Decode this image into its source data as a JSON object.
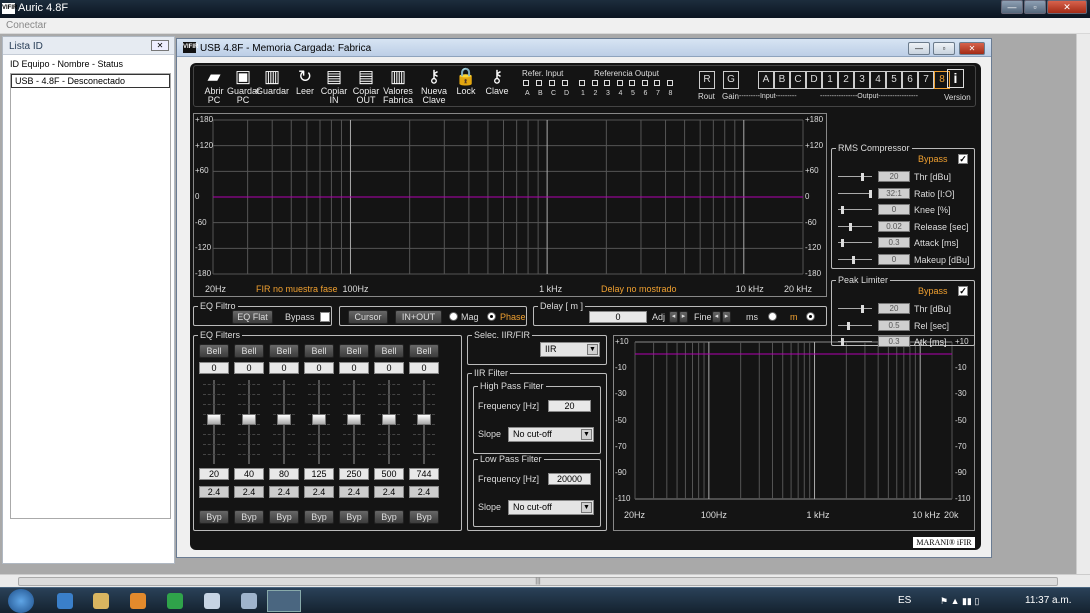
{
  "app": {
    "title": "Auric 4.8F",
    "logo": "VIFIR",
    "menu": "Conectar"
  },
  "list_window": {
    "title": "Lista ID",
    "column_header": "ID Equipo - Nombre - Status",
    "rows": [
      "USB - 4.8F - Desconectado"
    ]
  },
  "eq_window": {
    "title": "USB  4.8F  - Memoria Cargada: Fabrica"
  },
  "toolbar": [
    {
      "label1": "Abrir",
      "label2": "PC",
      "icon": "folder-icon"
    },
    {
      "label1": "Guardar",
      "label2": "PC",
      "icon": "save-icon"
    },
    {
      "label1": "Guardar",
      "label2": "",
      "icon": "chip-icon"
    },
    {
      "label1": "Leer",
      "label2": "",
      "icon": "refresh-icon"
    },
    {
      "label1": "Copiar",
      "label2": "IN",
      "icon": "copy-icon"
    },
    {
      "label1": "Copiar",
      "label2": "OUT",
      "icon": "copy-icon"
    },
    {
      "label1": "Valores",
      "label2": "Fabrica",
      "icon": "chip-icon"
    },
    {
      "label1": "Nueva",
      "label2": "Clave",
      "icon": "key-icon"
    },
    {
      "label1": "Lock",
      "label2": "",
      "icon": "lock-icon"
    },
    {
      "label1": "Clave",
      "label2": "",
      "icon": "key-icon"
    }
  ],
  "refer_input": {
    "title": "Refer. Input",
    "labels": [
      "A",
      "B",
      "C",
      "D"
    ]
  },
  "ref_output": {
    "title": "Referencia Output",
    "labels": [
      "1",
      "2",
      "3",
      "4",
      "5",
      "6",
      "7",
      "8"
    ]
  },
  "route_gain": [
    {
      "btn": "R",
      "label": "Rout"
    },
    {
      "btn": "G",
      "label": "Gain"
    }
  ],
  "input_channels": [
    "A",
    "B",
    "C",
    "D"
  ],
  "output_channels": [
    "1",
    "2",
    "3",
    "4",
    "5",
    "6",
    "7",
    "8"
  ],
  "selected_output": "8",
  "input_caption": "---------Input---------",
  "output_caption": "----------------Output-----------------",
  "version": {
    "label": "Version",
    "icon": "i"
  },
  "main_graph": {
    "y_ticks": [
      "+180",
      "+120",
      "+60",
      "0",
      "-60",
      "-120",
      "-180"
    ],
    "x_labels": [
      "20Hz",
      "100Hz",
      "1 kHz",
      "10 kHz",
      "20 kHz"
    ],
    "note_fir": "FIR no muestra fase",
    "note_delay": "Delay no mostrado",
    "trace_color": "#b000b0"
  },
  "eq_filtro": {
    "title": "EQ Filtro",
    "eq_flat": "EQ Flat",
    "bypass": "Bypass"
  },
  "display_opts": {
    "cursor": "Cursor",
    "in_out": "IN+OUT",
    "mag": "Mag",
    "phase": "Phase",
    "selected": "Phase"
  },
  "delay": {
    "title": "Delay [ m ]",
    "value": "0",
    "adj": "Adj",
    "fine": "Fine",
    "ms": "ms",
    "m": "m",
    "unit": "m"
  },
  "eq_filters": {
    "title": "EQ Filters",
    "bands": [
      {
        "type": "Bell",
        "gain": "0",
        "freq": "20",
        "q": "2.4",
        "byp": "Byp"
      },
      {
        "type": "Bell",
        "gain": "0",
        "freq": "40",
        "q": "2.4",
        "byp": "Byp"
      },
      {
        "type": "Bell",
        "gain": "0",
        "freq": "80",
        "q": "2.4",
        "byp": "Byp"
      },
      {
        "type": "Bell",
        "gain": "0",
        "freq": "125",
        "q": "2.4",
        "byp": "Byp"
      },
      {
        "type": "Bell",
        "gain": "0",
        "freq": "250",
        "q": "2.4",
        "byp": "Byp"
      },
      {
        "type": "Bell",
        "gain": "0",
        "freq": "500",
        "q": "2.4",
        "byp": "Byp"
      },
      {
        "type": "Bell",
        "gain": "0",
        "freq": "744",
        "q": "2.4",
        "byp": "Byp"
      }
    ]
  },
  "selec": {
    "title": "Selec. IIR/FIR",
    "value": "IIR"
  },
  "iir": {
    "title": "IIR Filter",
    "hp": {
      "title": "High Pass Filter",
      "freq_label": "Frequency [Hz]",
      "freq": "20",
      "slope_label": "Slope",
      "slope": "No cut-off"
    },
    "lp": {
      "title": "Low Pass Filter",
      "freq_label": "Frequency [Hz]",
      "freq": "20000",
      "slope_label": "Slope",
      "slope": "No cut-off"
    }
  },
  "small_graph": {
    "y_ticks": [
      "+10",
      "-10",
      "-30",
      "-50",
      "-70",
      "-90",
      "-110"
    ],
    "x_labels": [
      "20Hz",
      "100Hz",
      "1 kHz",
      "10 kHz",
      "20k"
    ]
  },
  "rms": {
    "title": "RMS Compressor",
    "bypass": "Bypass",
    "params": [
      {
        "value": "20",
        "label": "Thr [dBu]",
        "level": 0.75
      },
      {
        "value": "32:1",
        "label": "Ratio [I:O]",
        "level": 1.0
      },
      {
        "value": "0",
        "label": "Knee [%]",
        "level": 0.1
      },
      {
        "value": "0.02",
        "label": "Release [sec]",
        "level": 0.35
      },
      {
        "value": "0.3",
        "label": "Attack [ms]",
        "level": 0.1
      },
      {
        "value": "0",
        "label": "Makeup [dBu]",
        "level": 0.45
      }
    ]
  },
  "limiter": {
    "title": "Peak Limiter",
    "bypass": "Bypass",
    "params": [
      {
        "value": "20",
        "label": "Thr [dBu]",
        "level": 0.75
      },
      {
        "value": "0.5",
        "label": "Rel [sec]",
        "level": 0.3
      },
      {
        "value": "0.3",
        "label": "Atk [ms]",
        "level": 0.1
      }
    ]
  },
  "brand": "MARANI® iFIR",
  "taskbar": {
    "lang": "ES",
    "time": "11:37 a.m."
  }
}
